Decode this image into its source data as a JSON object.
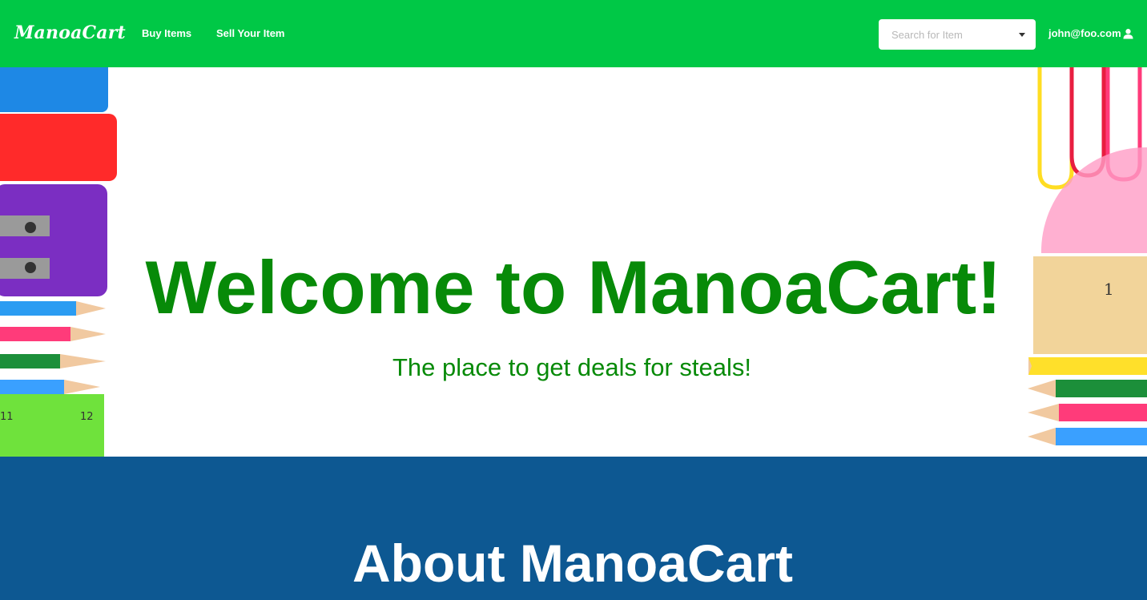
{
  "navbar": {
    "brand": "ManoaCart",
    "links": [
      "Buy Items",
      "Sell Your Item"
    ],
    "search_placeholder": "Search for Item",
    "user_email": "john@foo.com"
  },
  "hero": {
    "title": "Welcome to ManoaCart!",
    "subtitle": "The place to get deals for steals!"
  },
  "about": {
    "title": "About ManoaCart"
  },
  "colors": {
    "navbar": "#00c846",
    "hero_text": "#078a08",
    "about_bg": "#0d5892"
  },
  "icons": [
    "user-icon",
    "caret-down-icon"
  ]
}
